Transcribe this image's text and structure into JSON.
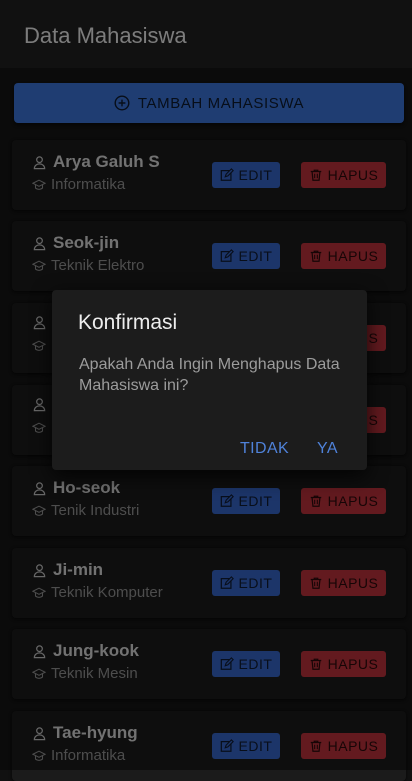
{
  "header": {
    "title": "Data Mahasiswa"
  },
  "actions": {
    "add_label": "TAMBAH MAHASISWA"
  },
  "students": [
    {
      "name": "Arya Galuh S",
      "major": "Informatika"
    },
    {
      "name": "Seok-jin",
      "major": "Teknik Elektro"
    },
    {
      "name": "",
      "major": ""
    },
    {
      "name": "",
      "major": ""
    },
    {
      "name": "Ho-seok",
      "major": "Tenik Industri"
    },
    {
      "name": "Ji-min",
      "major": "Teknik Komputer"
    },
    {
      "name": "Jung-kook",
      "major": "Teknik Mesin"
    },
    {
      "name": "Tae-hyung",
      "major": "Informatika"
    }
  ],
  "row_buttons": {
    "edit_label": "EDIT",
    "delete_label": "HAPUS"
  },
  "dialog": {
    "title": "Konfirmasi",
    "message": "Apakah Anda Ingin Menghapus Data Mahasiswa ini?",
    "cancel_label": "TIDAK",
    "confirm_label": "YA"
  },
  "colors": {
    "primary": "#3a6fcf",
    "danger": "#b43139",
    "dialog_action": "#4f82d9"
  },
  "icons": {
    "add": "plus-circle-icon",
    "person": "person-icon",
    "major": "graduation-cap-icon",
    "edit": "edit-icon",
    "delete": "trash-icon"
  }
}
